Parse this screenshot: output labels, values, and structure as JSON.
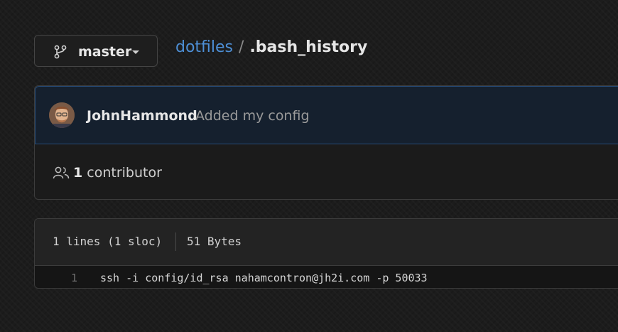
{
  "branch": {
    "label": "master",
    "icon": "git-branch-icon"
  },
  "breadcrumb": {
    "repo": "dotfiles",
    "separator": "/",
    "file": ".bash_history"
  },
  "commit": {
    "author": "JohnHammond",
    "message": "Added my config",
    "avatar_icon": "user-avatar"
  },
  "contributors": {
    "icon": "people-icon",
    "count": "1",
    "label": "contributor"
  },
  "file": {
    "lines": "1 lines (1 sloc)",
    "size": "51 Bytes",
    "code": [
      {
        "line_number": "1",
        "text": "ssh -i config/id_rsa nahamcontron@jh2i.com -p 50033"
      }
    ]
  },
  "colors": {
    "link": "#4d8fd6",
    "background": "#1c1c1c",
    "commit_header_bg": "#15202e",
    "commit_header_border": "#264b77"
  }
}
